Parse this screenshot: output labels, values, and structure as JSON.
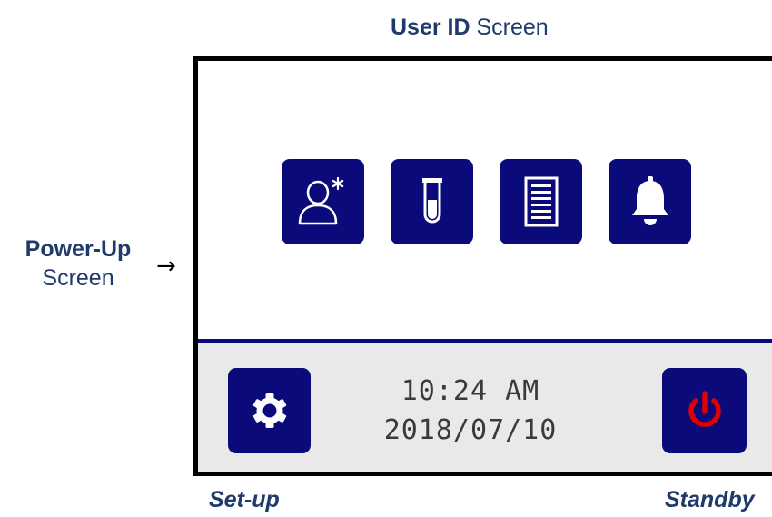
{
  "labels": {
    "user_id_bold": "User ID",
    "user_id_rest": " Screen",
    "power_up_bold": "Power-Up",
    "power_up_rest": "Screen",
    "arrow": "→",
    "setup": "Set-up",
    "standby": "Standby"
  },
  "screen": {
    "tiles": [
      {
        "icon": "user-icon"
      },
      {
        "icon": "test-tube-icon"
      },
      {
        "icon": "document-list-icon"
      },
      {
        "icon": "bell-icon"
      }
    ],
    "footer": {
      "time": "10:24 AM",
      "date": "2018/07/10",
      "setup_icon": "gear-icon",
      "standby_icon": "power-icon"
    }
  },
  "colors": {
    "tile_background": "#0a0a7a",
    "footer_background": "#e9e9e9",
    "power_icon": "#e00000",
    "label_text": "#1f3a6b",
    "divider": "#0a0a7a"
  }
}
